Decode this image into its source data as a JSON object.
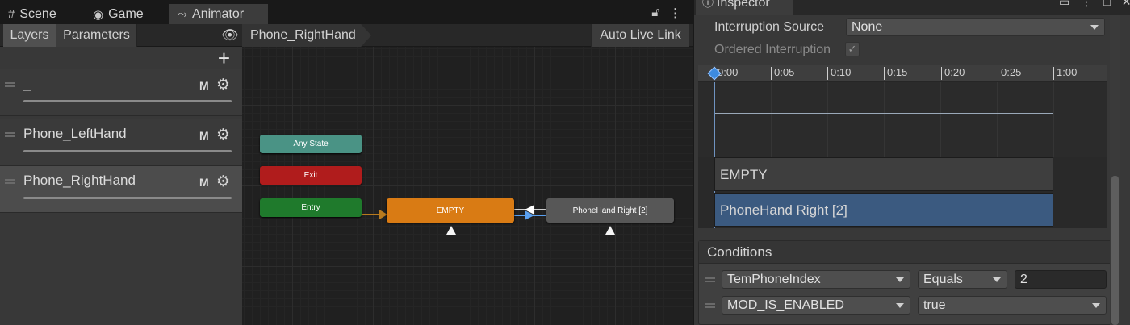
{
  "tabs": [
    {
      "icon": "#",
      "icon_name": "grid-icon",
      "label": "Scene"
    },
    {
      "icon": "◉",
      "icon_name": "gamepad-icon",
      "label": "Game"
    },
    {
      "icon": "⤳",
      "icon_name": "animator-icon",
      "label": "Animator"
    }
  ],
  "animator": {
    "sub_tabs": {
      "layers": "Layers",
      "parameters": "Parameters"
    },
    "breadcrumb": "Phone_RightHand",
    "auto_live_link": "Auto Live Link",
    "layers": [
      {
        "name": "_",
        "m": "M"
      },
      {
        "name": "Phone_LeftHand",
        "m": "M"
      },
      {
        "name": "Phone_RightHand",
        "m": "M"
      }
    ],
    "nodes": {
      "any_state": "Any State",
      "exit": "Exit",
      "entry": "Entry",
      "empty": "EMPTY",
      "phonehand": "PhoneHand Right [2]"
    }
  },
  "inspector": {
    "tab_label": "Inspector",
    "interruption_source_label": "Interruption Source",
    "interruption_source_value": "None",
    "ordered_interruption_label": "Ordered Interruption",
    "ruler_ticks": [
      "0:00",
      "0:05",
      "0:10",
      "0:15",
      "0:20",
      "0:25",
      "1:00"
    ],
    "bars": [
      "EMPTY",
      "PhoneHand Right [2]"
    ],
    "conditions_title": "Conditions",
    "conditions": [
      {
        "parameter": "TemPhoneIndex",
        "mode": "Equals",
        "value": "2"
      },
      {
        "parameter": "MOD_IS_ENABLED",
        "mode": "true"
      }
    ]
  },
  "colors": {
    "any_state": "#4a9385",
    "exit": "#b01c1c",
    "entry": "#1f7a2c",
    "default_state": "#d97b14",
    "state": "#575757",
    "selected_bar": "#3b5a80"
  }
}
